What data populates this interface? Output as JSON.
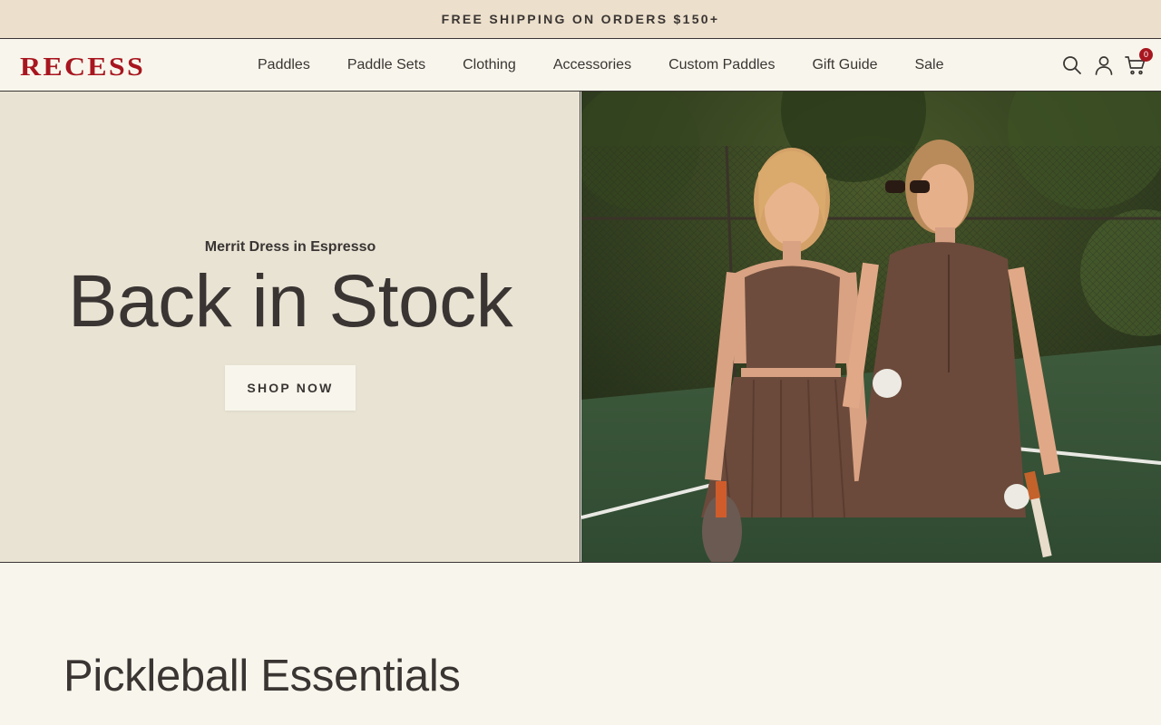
{
  "announcement": {
    "text": "FREE SHIPPING ON ORDERS $150+"
  },
  "header": {
    "logo_text": "RECESS",
    "brand_color": "#a8161f",
    "nav": [
      {
        "label": "Paddles"
      },
      {
        "label": "Paddle Sets"
      },
      {
        "label": "Clothing"
      },
      {
        "label": "Accessories"
      },
      {
        "label": "Custom Paddles"
      },
      {
        "label": "Gift Guide"
      },
      {
        "label": "Sale"
      }
    ],
    "icons": [
      "search-icon",
      "account-icon",
      "cart-icon"
    ],
    "cart_count": "0"
  },
  "hero": {
    "subtitle": "Merrit Dress in Espresso",
    "title": "Back in Stock",
    "button_label": "SHOP NOW",
    "image_subject": "hero-image"
  },
  "main": {
    "section_title": "Pickleball Essentials"
  }
}
